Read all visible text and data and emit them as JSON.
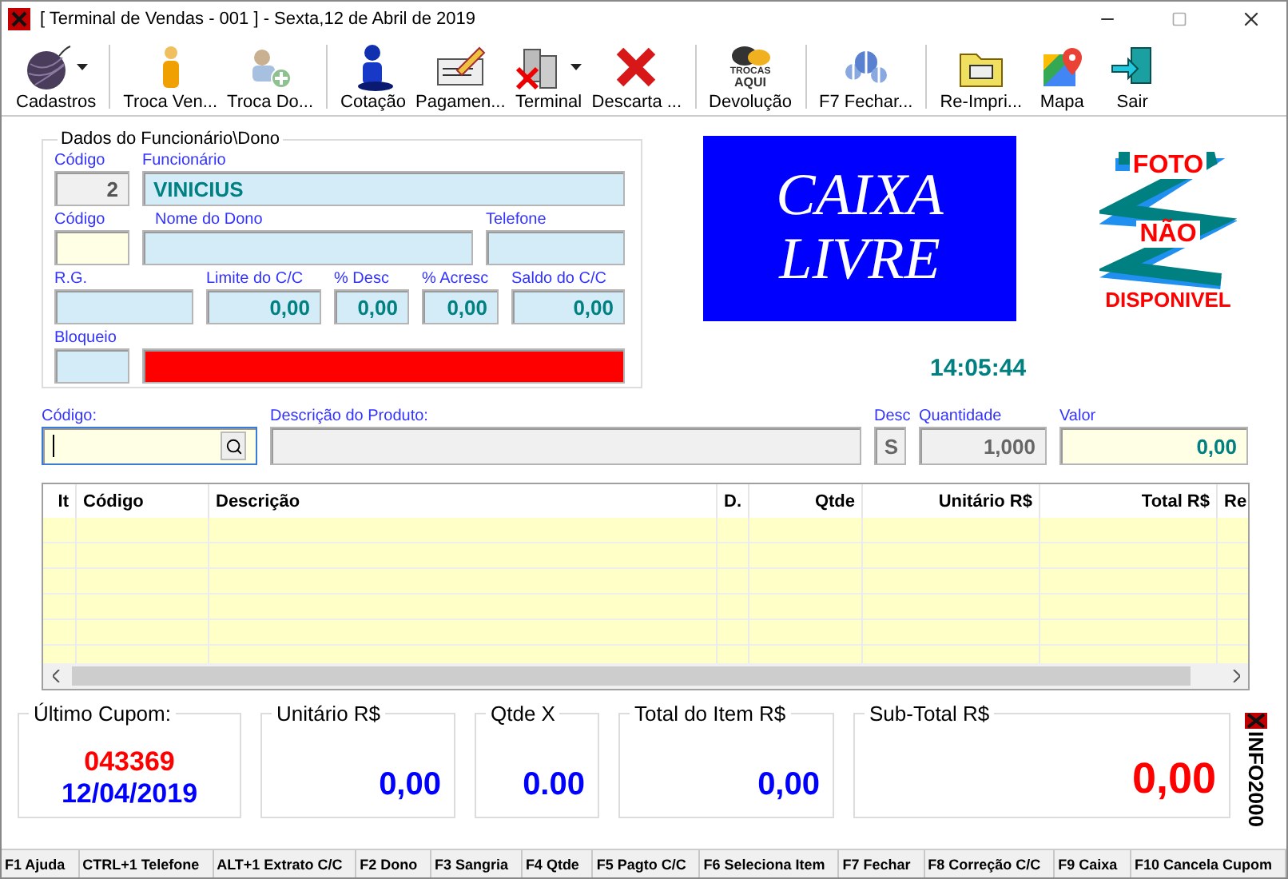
{
  "window": {
    "title": "[ Terminal de Vendas - 001 ] - Sexta,12 de Abril de 2019"
  },
  "toolbar": {
    "groups": [
      [
        {
          "label": "Cadastros",
          "kind": "yarn",
          "dropdown": true
        }
      ],
      [
        {
          "label": "Troca Ven...",
          "kind": "person",
          "dropdown": false
        },
        {
          "label": "Troca Do...",
          "kind": "swap",
          "dropdown": false
        }
      ],
      [
        {
          "label": "Cotação",
          "kind": "user",
          "dropdown": false
        },
        {
          "label": "Pagamen...",
          "kind": "pen",
          "dropdown": false
        },
        {
          "label": "Terminal",
          "kind": "computers",
          "dropdown": true
        },
        {
          "label": "Descarta ...",
          "kind": "cross",
          "dropdown": false
        }
      ],
      [
        {
          "label": "Devolução",
          "kind": "bubbles",
          "dropdown": false,
          "icon_text": [
            "TROCAS",
            "AQUI"
          ]
        }
      ],
      [
        {
          "label": "F7 Fechar...",
          "kind": "dollars",
          "dropdown": false
        }
      ],
      [
        {
          "label": "Re-Impri...",
          "kind": "printer",
          "dropdown": false
        },
        {
          "label": "Mapa",
          "kind": "map",
          "dropdown": false
        },
        {
          "label": "Sair",
          "kind": "exit",
          "dropdown": false
        }
      ]
    ]
  },
  "employee": {
    "title": "Dados do Funcionário\\Dono",
    "rows": [
      [
        {
          "label": "Código",
          "value": "2",
          "kind": "readonly"
        },
        {
          "label": "Funcionário",
          "value": "VINICIUS",
          "kind": "info"
        }
      ],
      [
        {
          "label": "Código",
          "kind": "entry"
        },
        {
          "label": "Nome do Dono",
          "kind": "info"
        },
        {
          "label": "Telefone",
          "kind": "info"
        }
      ],
      [
        {
          "label": "R.G.",
          "kind": "info"
        },
        {
          "label": "Limite do C/C",
          "value": "0,00",
          "kind": "info"
        },
        {
          "label": "% Desc",
          "value": "0,00",
          "kind": "info"
        },
        {
          "label": "% Acresc",
          "value": "0,00",
          "kind": "info"
        },
        {
          "label": "Saldo do C/C",
          "value": "0,00",
          "kind": "info"
        }
      ],
      [
        {
          "label": "Bloqueio",
          "kind": "info"
        },
        {
          "kind": "status",
          "alert": true
        }
      ]
    ]
  },
  "status_panel": {
    "lines": [
      "CAIXA",
      "LIVRE"
    ]
  },
  "photo": {
    "lines": [
      "FOTO",
      "NÃO",
      "DISPONIVEL"
    ]
  },
  "clock": "14:05:44",
  "product": [
    {
      "label": "Código:",
      "kind": "entry",
      "focused": true
    },
    {
      "label": "Descrição do  Produto:",
      "kind": "readonly",
      "focused": false
    },
    {
      "label": "Desc",
      "value": "S",
      "kind": "readonly",
      "focused": false
    },
    {
      "label": "Quantidade",
      "value": "1,000",
      "kind": "readonly",
      "focused": false
    },
    {
      "label": "Valor",
      "value": "0,00",
      "kind": "entry",
      "focused": false
    }
  ],
  "table": {
    "columns": [
      "It",
      "Código",
      "Descrição",
      "D.",
      "Qtde",
      "Unitário R$",
      "Total R$",
      "Re"
    ]
  },
  "totals": [
    {
      "label": "Último Cupom:",
      "kind": "cupom",
      "values": [
        {
          "text": "043369",
          "color": "#ff0000"
        },
        {
          "text": "12/04/2019",
          "color": "#0000ff"
        }
      ]
    },
    {
      "label": "Unitário R$",
      "kind": "value",
      "values": [
        {
          "text": "0,00",
          "color": "#0000ff"
        }
      ]
    },
    {
      "label": "Qtde X",
      "kind": "value",
      "values": [
        {
          "text": "0.00",
          "color": "#0000ff"
        }
      ]
    },
    {
      "label": "Total do Item R$",
      "kind": "value",
      "values": [
        {
          "text": "0,00",
          "color": "#0000ff"
        }
      ]
    },
    {
      "label": "Sub-Total R$",
      "kind": "total",
      "values": [
        {
          "text": "0,00",
          "color": "#ff0000"
        }
      ]
    }
  ],
  "logo": "INFO2000",
  "status_bar": [
    "F1 Ajuda",
    "CTRL+1 Telefone",
    "ALT+1 Extrato C/C",
    "F2 Dono",
    "F3 Sangria",
    "F4 Qtde",
    "F5 Pagto C/C",
    "F6 Seleciona Item",
    "F7 Fechar",
    "F8 Correção C/C",
    "F9 Caixa",
    "F10 Cancela Cupom"
  ]
}
